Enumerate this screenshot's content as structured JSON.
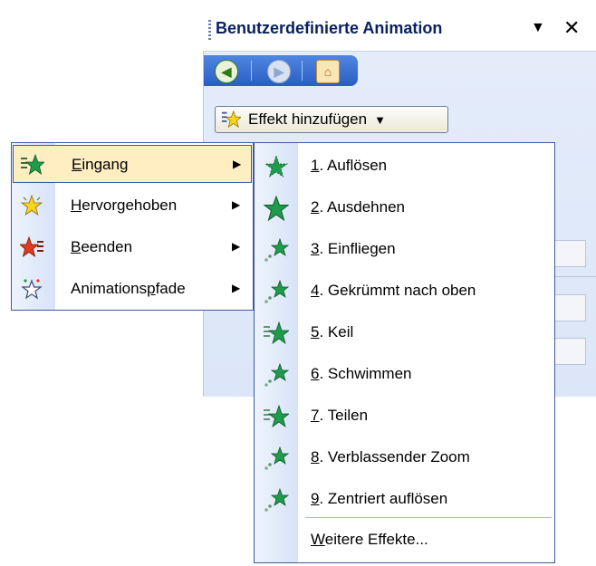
{
  "pane": {
    "title": "Benutzerdefinierte Animation",
    "menu_arrow": "▼",
    "close": "✕",
    "add_effect": {
      "label": "Effekt hinzufügen",
      "arrow": "▼"
    }
  },
  "main_menu": {
    "items": [
      {
        "mnemonic": "E",
        "rest": "ingang",
        "arrow": "▶",
        "icon": "entrance-star-icon"
      },
      {
        "mnemonic": "H",
        "rest": "ervorgehoben",
        "arrow": "▶",
        "icon": "emphasis-star-icon"
      },
      {
        "mnemonic": "B",
        "rest": "eenden",
        "arrow": "▶",
        "icon": "exit-star-icon"
      },
      {
        "pre": "Animations",
        "mnemonic": "p",
        "rest": "fade",
        "arrow": "▶",
        "icon": "motion-path-star-icon"
      }
    ]
  },
  "sub_menu": {
    "items": [
      {
        "num": "1",
        "rest": ". Auflösen",
        "icon": "dissolve-icon"
      },
      {
        "num": "2",
        "rest": ". Ausdehnen",
        "icon": "expand-icon"
      },
      {
        "num": "3",
        "rest": ". Einfliegen",
        "icon": "fly-in-icon"
      },
      {
        "num": "4",
        "rest": ". Gekrümmt nach oben",
        "icon": "curve-up-icon"
      },
      {
        "num": "5",
        "rest": ". Keil",
        "icon": "wedge-icon"
      },
      {
        "num": "6",
        "rest": ". Schwimmen",
        "icon": "float-icon"
      },
      {
        "num": "7",
        "rest": ". Teilen",
        "icon": "split-icon"
      },
      {
        "num": "8",
        "rest": ". Verblassender Zoom",
        "icon": "faded-zoom-icon"
      },
      {
        "num": "9",
        "rest": ". Zentriert auflösen",
        "icon": "center-dissolve-icon"
      }
    ],
    "more": {
      "mnemonic": "W",
      "rest": "eitere Effekte..."
    }
  },
  "colors": {
    "accent": "#3b5c9c",
    "highlight": "#ffeec2",
    "star_green": "#1f9b4c",
    "star_yellow": "#f7d51e",
    "star_red": "#e23a1c"
  }
}
